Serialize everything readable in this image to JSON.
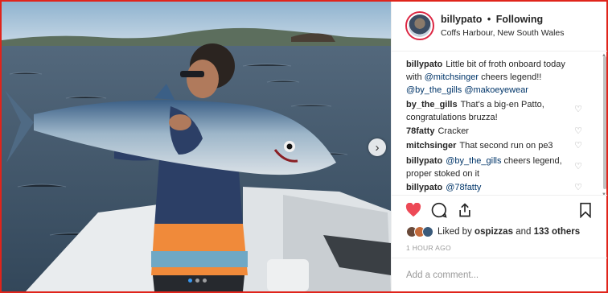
{
  "post": {
    "image_alt": "Man on a boat holding a large mackerel",
    "carousel": {
      "slides": 3,
      "active": 1
    }
  },
  "header": {
    "username": "billypato",
    "separator": "•",
    "follow_status": "Following",
    "location": "Coffs Harbour, New South Wales"
  },
  "comments": [
    {
      "user": "billypato",
      "segments": [
        {
          "text": "Little bit of froth onboard today with ",
          "mention": false
        },
        {
          "text": "@mitchsinger",
          "mention": true
        },
        {
          "text": " cheers legend!! ",
          "mention": false
        },
        {
          "text": "@by_the_gills",
          "mention": true
        },
        {
          "text": " ",
          "mention": false
        },
        {
          "text": "@makoeyewear",
          "mention": true
        }
      ],
      "likeable": false
    },
    {
      "user": "by_the_gills",
      "segments": [
        {
          "text": "That's a big-en Patto, congratulations bruzza!",
          "mention": false
        }
      ],
      "likeable": true
    },
    {
      "user": "78fatty",
      "segments": [
        {
          "text": "Cracker",
          "mention": false
        }
      ],
      "likeable": true
    },
    {
      "user": "mitchsinger",
      "segments": [
        {
          "text": "That second run on pe3",
          "mention": false
        }
      ],
      "likeable": true
    },
    {
      "user": "billypato",
      "segments": [
        {
          "text": "@by_the_gills",
          "mention": true
        },
        {
          "text": " cheers legend, proper stoked on it",
          "mention": false
        }
      ],
      "likeable": true
    },
    {
      "user": "billypato",
      "segments": [
        {
          "text": "@78fatty",
          "mention": true
        }
      ],
      "likeable": true
    }
  ],
  "actions": {
    "like_icon": "heart-filled-icon",
    "comment_icon": "comment-bubble-icon",
    "share_icon": "share-upload-icon",
    "save_icon": "bookmark-icon"
  },
  "likes": {
    "prefix": "Liked by",
    "first_user": "ospizzas",
    "joiner": "and",
    "others_count": "133 others"
  },
  "timestamp": "1 HOUR AGO",
  "add_comment": {
    "placeholder": "Add a comment..."
  },
  "colors": {
    "accent_red": "#ed4956",
    "mention_blue": "#003569",
    "frame_red": "#e0241b"
  }
}
